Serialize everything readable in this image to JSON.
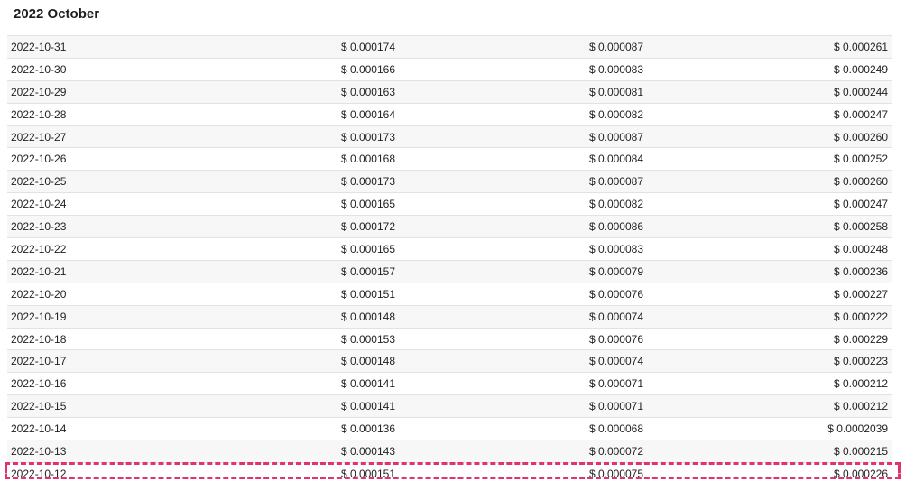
{
  "title": "2022 October",
  "rows": [
    {
      "date": "2022-10-31",
      "a": "$ 0.000174",
      "b": "$ 0.000087",
      "c": "$ 0.000261"
    },
    {
      "date": "2022-10-30",
      "a": "$ 0.000166",
      "b": "$ 0.000083",
      "c": "$ 0.000249"
    },
    {
      "date": "2022-10-29",
      "a": "$ 0.000163",
      "b": "$ 0.000081",
      "c": "$ 0.000244"
    },
    {
      "date": "2022-10-28",
      "a": "$ 0.000164",
      "b": "$ 0.000082",
      "c": "$ 0.000247"
    },
    {
      "date": "2022-10-27",
      "a": "$ 0.000173",
      "b": "$ 0.000087",
      "c": "$ 0.000260"
    },
    {
      "date": "2022-10-26",
      "a": "$ 0.000168",
      "b": "$ 0.000084",
      "c": "$ 0.000252"
    },
    {
      "date": "2022-10-25",
      "a": "$ 0.000173",
      "b": "$ 0.000087",
      "c": "$ 0.000260"
    },
    {
      "date": "2022-10-24",
      "a": "$ 0.000165",
      "b": "$ 0.000082",
      "c": "$ 0.000247"
    },
    {
      "date": "2022-10-23",
      "a": "$ 0.000172",
      "b": "$ 0.000086",
      "c": "$ 0.000258"
    },
    {
      "date": "2022-10-22",
      "a": "$ 0.000165",
      "b": "$ 0.000083",
      "c": "$ 0.000248"
    },
    {
      "date": "2022-10-21",
      "a": "$ 0.000157",
      "b": "$ 0.000079",
      "c": "$ 0.000236"
    },
    {
      "date": "2022-10-20",
      "a": "$ 0.000151",
      "b": "$ 0.000076",
      "c": "$ 0.000227"
    },
    {
      "date": "2022-10-19",
      "a": "$ 0.000148",
      "b": "$ 0.000074",
      "c": "$ 0.000222"
    },
    {
      "date": "2022-10-18",
      "a": "$ 0.000153",
      "b": "$ 0.000076",
      "c": "$ 0.000229"
    },
    {
      "date": "2022-10-17",
      "a": "$ 0.000148",
      "b": "$ 0.000074",
      "c": "$ 0.000223"
    },
    {
      "date": "2022-10-16",
      "a": "$ 0.000141",
      "b": "$ 0.000071",
      "c": "$ 0.000212"
    },
    {
      "date": "2022-10-15",
      "a": "$ 0.000141",
      "b": "$ 0.000071",
      "c": "$ 0.000212"
    },
    {
      "date": "2022-10-14",
      "a": "$ 0.000136",
      "b": "$ 0.000068",
      "c": "$ 0.0002039"
    },
    {
      "date": "2022-10-13",
      "a": "$ 0.000143",
      "b": "$ 0.000072",
      "c": "$ 0.000215"
    },
    {
      "date": "2022-10-12",
      "a": "$ 0.000151",
      "b": "$ 0.000075",
      "c": "$ 0.000226"
    }
  ],
  "highlight_color": "#e0336b"
}
